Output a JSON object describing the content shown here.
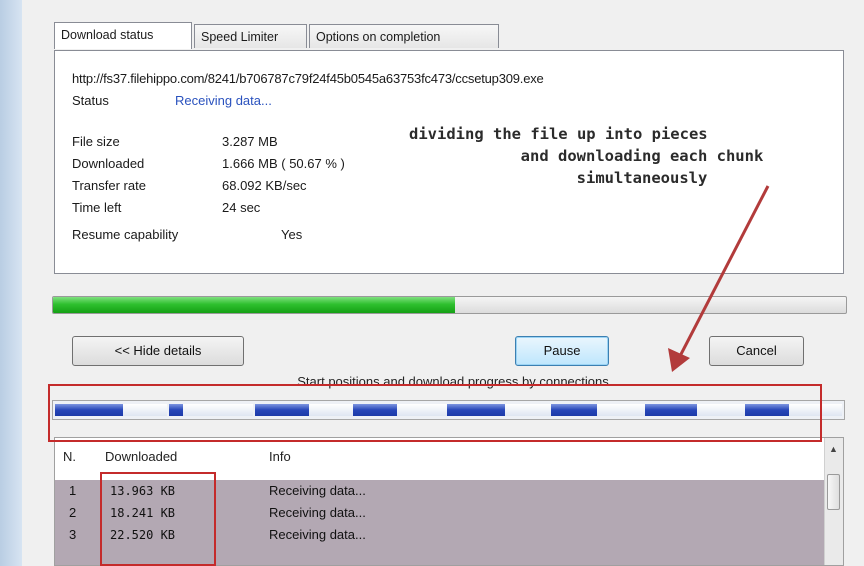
{
  "tabs": [
    {
      "label": "Download status",
      "active": true
    },
    {
      "label": "Speed Limiter",
      "active": false
    },
    {
      "label": "Options on completion",
      "active": false
    }
  ],
  "download": {
    "url": "http://fs37.filehippo.com/8241/b706787c79f24f45b0545a63753fc473/ccsetup309.exe",
    "status_label": "Status",
    "status_value": "Receiving data...",
    "fields": [
      {
        "label": "File size",
        "value": "3.287  MB"
      },
      {
        "label": "Downloaded",
        "value": "1.666  MB  ( 50.67 % )"
      },
      {
        "label": "Transfer rate",
        "value": "68.092  KB/sec"
      },
      {
        "label": "Time left",
        "value": "24 sec"
      },
      {
        "label": "Resume capability",
        "value": "Yes"
      }
    ],
    "progress_fraction": 0.5067
  },
  "annotation": {
    "lines": [
      "dividing the file up into pieces",
      "and downloading each chunk",
      "simultaneously"
    ]
  },
  "buttons": {
    "hide_details": "<< Hide details",
    "pause": "Pause",
    "cancel": "Cancel"
  },
  "connections": {
    "title": "Start positions and download progress by connections",
    "columns": [
      "N.",
      "Downloaded",
      "Info"
    ],
    "rows": [
      {
        "n": "1",
        "downloaded": "13.963  KB",
        "info": "Receiving data..."
      },
      {
        "n": "2",
        "downloaded": "18.241  KB",
        "info": "Receiving data..."
      },
      {
        "n": "3",
        "downloaded": "22.520  KB",
        "info": "Receiving data..."
      }
    ]
  },
  "colors": {
    "progress_green": "#2fc02f",
    "segment_blue": "#2746b8",
    "highlight_red": "#c42b2b",
    "status_blue": "#2a52be",
    "row_background": "#b3a8b3"
  }
}
